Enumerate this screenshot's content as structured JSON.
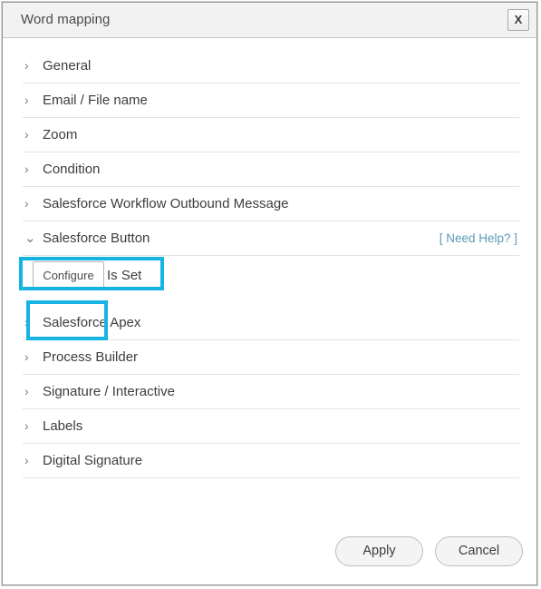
{
  "window": {
    "title": "Word mapping",
    "close_label": "X"
  },
  "accordion": {
    "collapsed_icon": "›",
    "expanded_icon": "⌄",
    "items": [
      {
        "label": "General",
        "expanded": false
      },
      {
        "label": "Email / File name",
        "expanded": false
      },
      {
        "label": "Zoom",
        "expanded": false
      },
      {
        "label": "Condition",
        "expanded": false
      },
      {
        "label": "Salesforce Workflow Outbound Message",
        "expanded": false
      },
      {
        "label": "Salesforce Button",
        "expanded": true,
        "need_help": "[ Need Help? ]"
      },
      {
        "label": "Salesforce Apex",
        "expanded": false
      },
      {
        "label": "Process Builder",
        "expanded": false
      },
      {
        "label": "Signature / Interactive",
        "expanded": false
      },
      {
        "label": "Labels",
        "expanded": false
      },
      {
        "label": "Digital Signature",
        "expanded": false
      }
    ]
  },
  "salesforce_button_panel": {
    "configure_label": "Configure",
    "status_text": "Is Set"
  },
  "footer": {
    "apply_label": "Apply",
    "cancel_label": "Cancel"
  },
  "colors": {
    "highlight": "#16b4e2",
    "link": "#5b9cb8",
    "titlebar_bg": "#f2f2f2"
  }
}
